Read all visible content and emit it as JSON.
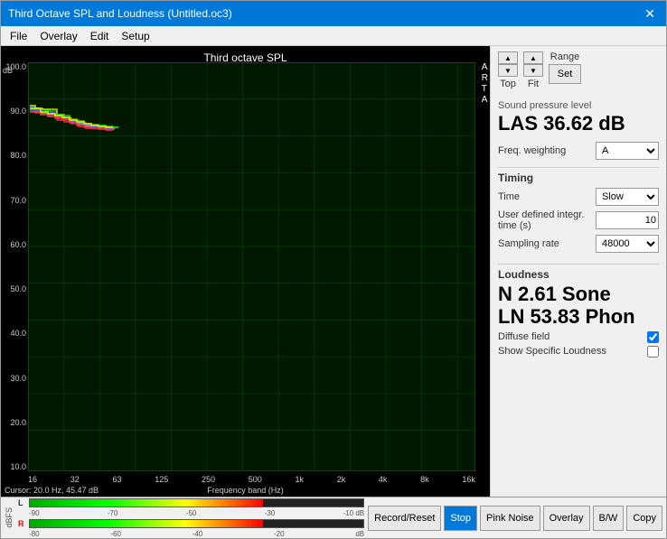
{
  "window": {
    "title": "Third Octave SPL and Loudness (Untitled.oc3)",
    "close_label": "✕"
  },
  "menu": {
    "items": [
      "File",
      "Overlay",
      "Edit",
      "Setup"
    ]
  },
  "chart": {
    "title": "Third octave SPL",
    "db_label": "dB",
    "arta_label": "A\nR\nT\nA",
    "y_labels": [
      "100.0",
      "90.0",
      "80.0",
      "70.0",
      "60.0",
      "50.0",
      "40.0",
      "30.0",
      "20.0",
      "10.0"
    ],
    "x_labels": [
      "16",
      "32",
      "63",
      "125",
      "250",
      "500",
      "1k",
      "2k",
      "4k",
      "8k",
      "16k"
    ],
    "x_axis_title": "Frequency band (Hz)",
    "cursor_info": "Cursor:  20.0 Hz, 45.47 dB"
  },
  "controls": {
    "top_label": "Top",
    "range_label": "Range",
    "fit_label": "Fit",
    "set_label": "Set",
    "up_arrow": "▲",
    "down_arrow": "▼"
  },
  "spl": {
    "section_label": "Sound pressure level",
    "value": "LAS 36.62 dB",
    "freq_weighting_label": "Freq. weighting",
    "freq_weighting_value": "A"
  },
  "timing": {
    "section_label": "Timing",
    "time_label": "Time",
    "time_value": "Slow",
    "user_defined_label": "User defined integr. time (s)",
    "user_defined_value": "10",
    "sampling_rate_label": "Sampling rate",
    "sampling_rate_value": "48000"
  },
  "loudness": {
    "section_label": "Loudness",
    "n_value": "N 2.61 Sone",
    "ln_value": "LN 53.83 Phon",
    "diffuse_field_label": "Diffuse field",
    "diffuse_field_checked": true,
    "show_specific_label": "Show Specific Loudness",
    "show_specific_checked": false
  },
  "bottom_bar": {
    "dbfs_label": "dBFS",
    "l_label": "L",
    "r_label": "R",
    "scale_marks": [
      "-90",
      "-70",
      "-50",
      "-30",
      "-10 dB"
    ],
    "scale_marks_r": [
      "-80",
      "-60",
      "-40",
      "-20",
      "dB"
    ],
    "buttons": [
      "Record/Reset",
      "Stop",
      "Pink Noise",
      "Overlay",
      "B/W",
      "Copy"
    ]
  }
}
